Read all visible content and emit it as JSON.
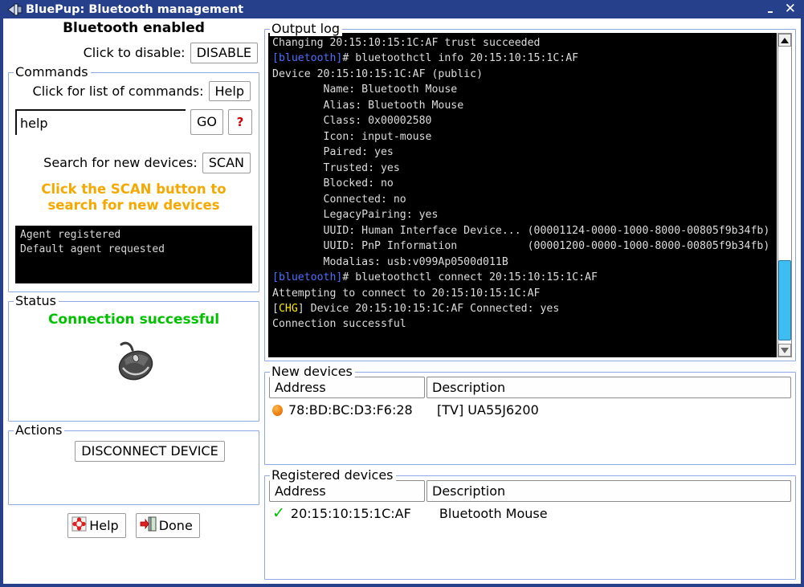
{
  "window": {
    "title": "BluePup: Bluetooth management",
    "icon": "bluetooth-dongle-icon",
    "minimize_label": "–",
    "close_label": "✕"
  },
  "left": {
    "enabled_heading": "Bluetooth enabled",
    "disable_label": "Click to disable:",
    "disable_button": "DISABLE",
    "commands": {
      "title": "Commands",
      "help_label": "Click for list of commands:",
      "help_button": "Help",
      "input_value": "help",
      "input_placeholder": "",
      "go_button": "GO",
      "question_icon": "?",
      "scan_label": "Search for new devices:",
      "scan_button": "SCAN",
      "warning_line1": "Click the SCAN button to",
      "warning_line2": "search for new devices",
      "warning_color": "#f5a800",
      "mini_log": [
        "Agent registered",
        "Default agent requested"
      ]
    },
    "status": {
      "title": "Status",
      "message": "Connection successful",
      "message_color": "#00c000",
      "icon": "mouse-icon"
    },
    "actions": {
      "title": "Actions",
      "disconnect_button": "DISCONNECT DEVICE"
    },
    "footer": {
      "help_button": "Help",
      "done_button": "Done"
    }
  },
  "right": {
    "log": {
      "title": "Output log",
      "lines": [
        [
          {
            "t": "Changing 20:15:10:15:1C:AF trust succeeded",
            "c": "plain"
          }
        ],
        [
          {
            "t": "[bluetooth]",
            "c": "blue"
          },
          {
            "t": "# bluetoothctl info 20:15:10:15:1C:AF",
            "c": "plain"
          }
        ],
        [
          {
            "t": "Device 20:15:10:15:1C:AF (public)",
            "c": "plain"
          }
        ],
        [
          {
            "t": "        Name: Bluetooth Mouse",
            "c": "plain"
          }
        ],
        [
          {
            "t": "        Alias: Bluetooth Mouse",
            "c": "plain"
          }
        ],
        [
          {
            "t": "        Class: 0x00002580",
            "c": "plain"
          }
        ],
        [
          {
            "t": "        Icon: input-mouse",
            "c": "plain"
          }
        ],
        [
          {
            "t": "        Paired: yes",
            "c": "plain"
          }
        ],
        [
          {
            "t": "        Trusted: yes",
            "c": "plain"
          }
        ],
        [
          {
            "t": "        Blocked: no",
            "c": "plain"
          }
        ],
        [
          {
            "t": "        Connected: no",
            "c": "plain"
          }
        ],
        [
          {
            "t": "        LegacyPairing: yes",
            "c": "plain"
          }
        ],
        [
          {
            "t": "        UUID: Human Interface Device... (00001124-0000-1000-8000-00805f9b34fb)",
            "c": "plain"
          }
        ],
        [
          {
            "t": "        UUID: PnP Information           (00001200-0000-1000-8000-00805f9b34fb)",
            "c": "plain"
          }
        ],
        [
          {
            "t": "        Modalias: usb:v099Ap0500d011B",
            "c": "plain"
          }
        ],
        [
          {
            "t": "[bluetooth]",
            "c": "blue"
          },
          {
            "t": "# bluetoothctl connect 20:15:10:15:1C:AF",
            "c": "plain"
          }
        ],
        [
          {
            "t": "Attempting to connect to 20:15:10:15:1C:AF",
            "c": "plain"
          }
        ],
        [
          {
            "t": "[",
            "c": "plain"
          },
          {
            "t": "CHG",
            "c": "yellow"
          },
          {
            "t": "] Device 20:15:10:15:1C:AF Connected: yes",
            "c": "plain"
          }
        ],
        [
          {
            "t": "Connection successful",
            "c": "plain"
          }
        ]
      ],
      "scroll_up_icon": "scroll-up-arrow-icon",
      "scroll_down_icon": "scroll-down-arrow-icon"
    },
    "new_devices": {
      "title": "New devices",
      "columns": [
        "Address",
        "Description"
      ],
      "rows": [
        {
          "status_icon": "orange-dot-icon",
          "address": "78:BD:BC:D3:F6:28",
          "description": "[TV] UA55J6200"
        }
      ]
    },
    "registered_devices": {
      "title": "Registered devices",
      "columns": [
        "Address",
        "Description"
      ],
      "rows": [
        {
          "status_icon": "green-check-icon",
          "address": "20:15:10:15:1C:AF",
          "description": "Bluetooth Mouse"
        }
      ]
    }
  }
}
